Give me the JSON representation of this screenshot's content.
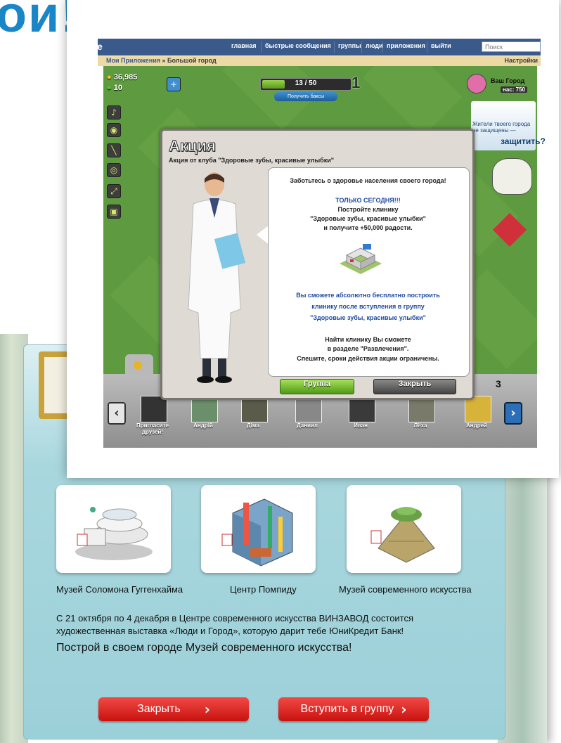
{
  "heading": {
    "text": "ои!"
  },
  "back_panel": {
    "museums": [
      {
        "name": "Музей Соломона Гуггенхайма"
      },
      {
        "name": "Центр Помпиду"
      },
      {
        "name": "Музей современного искусства"
      }
    ],
    "description_line1": "С 21 октября по 4 декабря в Центре современного искусства ВИНЗАВОД состоится",
    "description_line2": "художественная выставка «Люди и Город», которую дарит тебе ЮниКредит Банк!",
    "cta": "Построй в своем городе Музей современного искусства!",
    "close_label": "Закрыть",
    "join_label": "Вступить в группу",
    "button_chevron": "›"
  },
  "game": {
    "nav": {
      "logo": "e",
      "links": [
        "главная",
        "быстрые сообщения",
        "группы",
        "люди",
        "приложения",
        "выйти"
      ],
      "search_placeholder": "Поиск"
    },
    "breadcrumb": {
      "part1": "Мои Приложения",
      "sep": " » ",
      "part2": "Большой город",
      "settings": "Настройки"
    },
    "coins": "36,985",
    "money": "10",
    "progress": {
      "text": "13 / 50",
      "value": 13,
      "max": 50
    },
    "level": "1",
    "get_bucks": "Получить баксы",
    "city": {
      "label": "Ваш Город",
      "population_label": "нас: 750"
    },
    "ad": {
      "text": "Жители твоего города не защищены —",
      "big": "защитить?"
    },
    "friends": [
      {
        "name": "Пригласите друзей!"
      },
      {
        "name": "Андрій"
      },
      {
        "name": "Діма"
      },
      {
        "name": "Даниил"
      },
      {
        "name": "Иван"
      },
      {
        "name": "Лёха"
      },
      {
        "name": "Андрей"
      }
    ],
    "friends_count_fragment": "3",
    "dialog": {
      "title": "Акция",
      "subtitle": "Акция от клуба \"Здоровые зубы, красивые улыбки\"",
      "line1": "Заботьтесь о здоровье населения своего города!",
      "today": "ТОЛЬКО СЕГОДНЯ!!!",
      "build1": "Постройте клинику",
      "build2": "\"Здоровые зубы, красивые улыбки\"",
      "build3": "и получите +50,000 радости.",
      "free1": "Вы сможете абсолютно бесплатно построить",
      "free2": "клинику после вступления в группу",
      "free3": "\"Здоровые зубы, красивые улыбки\"",
      "find1": "Найти клинику Вы сможете",
      "find2": "в разделе \"Развлечения\".",
      "find3": "Спешите, сроки действия акции ограничены.",
      "btn_group": "Группа",
      "btn_close": "Закрыть"
    }
  }
}
